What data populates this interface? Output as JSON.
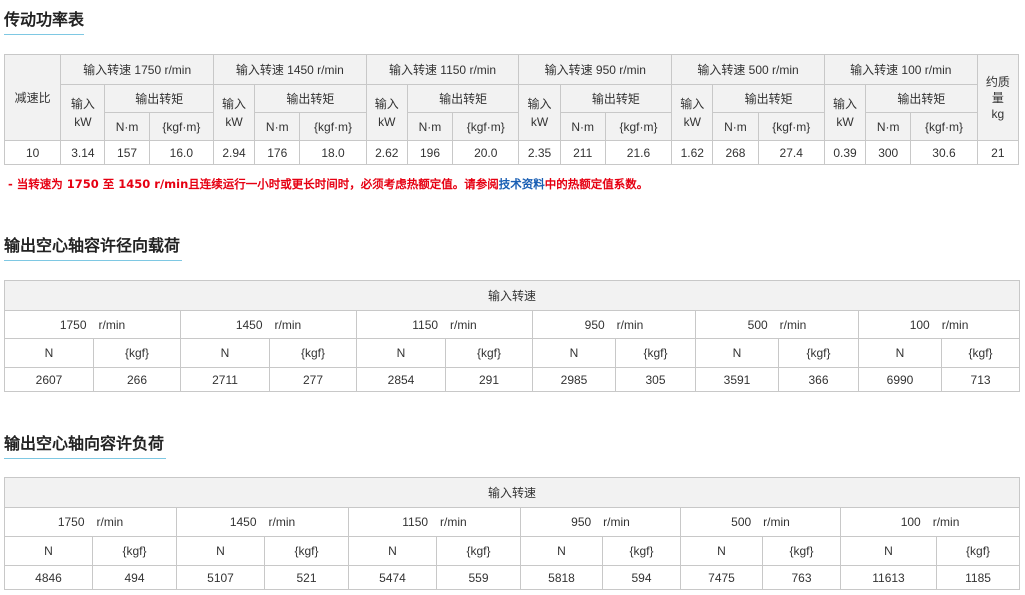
{
  "power_table": {
    "title": "传动功率表",
    "col_reduction": "减速比",
    "speed_headers": [
      "输入转速 1750 r/min",
      "输入转速 1450 r/min",
      "输入转速 1150 r/min",
      "输入转速 950 r/min",
      "输入转速 500 r/min",
      "输入转速 100 r/min"
    ],
    "input_label": "输入",
    "input_unit": "kW",
    "output_torque": "输出转矩",
    "unit_nm": "N·m",
    "unit_kgfm": "{kgf·m}",
    "mass_label": "约质量",
    "mass_unit": "kg",
    "row": {
      "ratio": "10",
      "groups": [
        {
          "kw": "3.14",
          "nm": "157",
          "kgfm": "16.0"
        },
        {
          "kw": "2.94",
          "nm": "176",
          "kgfm": "18.0"
        },
        {
          "kw": "2.62",
          "nm": "196",
          "kgfm": "20.0"
        },
        {
          "kw": "2.35",
          "nm": "211",
          "kgfm": "21.6"
        },
        {
          "kw": "1.62",
          "nm": "268",
          "kgfm": "27.4"
        },
        {
          "kw": "0.39",
          "nm": "300",
          "kgfm": "30.6"
        }
      ],
      "mass": "21"
    }
  },
  "note": {
    "prefix": "- 当转速为 1750 至 1450 r/min且连续运行一小时或更长时间时，必须考虑热额定值。请参阅",
    "link": "技术资料",
    "suffix": "中的热额定值系数。"
  },
  "radial_table": {
    "title": "输出空心轴容许径向载荷",
    "header": "输入转速",
    "speeds": [
      "1750　r/min",
      "1450　r/min",
      "1150　r/min",
      "950　r/min",
      "500　r/min",
      "100　r/min"
    ],
    "unit_n": "N",
    "unit_kgf": "{kgf}",
    "values": [
      {
        "n": "2607",
        "kgf": "266"
      },
      {
        "n": "2711",
        "kgf": "277"
      },
      {
        "n": "2854",
        "kgf": "291"
      },
      {
        "n": "2985",
        "kgf": "305"
      },
      {
        "n": "3591",
        "kgf": "366"
      },
      {
        "n": "6990",
        "kgf": "713"
      }
    ]
  },
  "axial_table": {
    "title": "输出空心轴向容许负荷",
    "header": "输入转速",
    "speeds": [
      "1750　r/min",
      "1450　r/min",
      "1150　r/min",
      "950　r/min",
      "500　r/min",
      "100　r/min"
    ],
    "unit_n": "N",
    "unit_kgf": "{kgf}",
    "values": [
      {
        "n": "4846",
        "kgf": "494"
      },
      {
        "n": "5107",
        "kgf": "521"
      },
      {
        "n": "5474",
        "kgf": "559"
      },
      {
        "n": "5818",
        "kgf": "594"
      },
      {
        "n": "7475",
        "kgf": "763"
      },
      {
        "n": "11613",
        "kgf": "1185"
      }
    ]
  }
}
